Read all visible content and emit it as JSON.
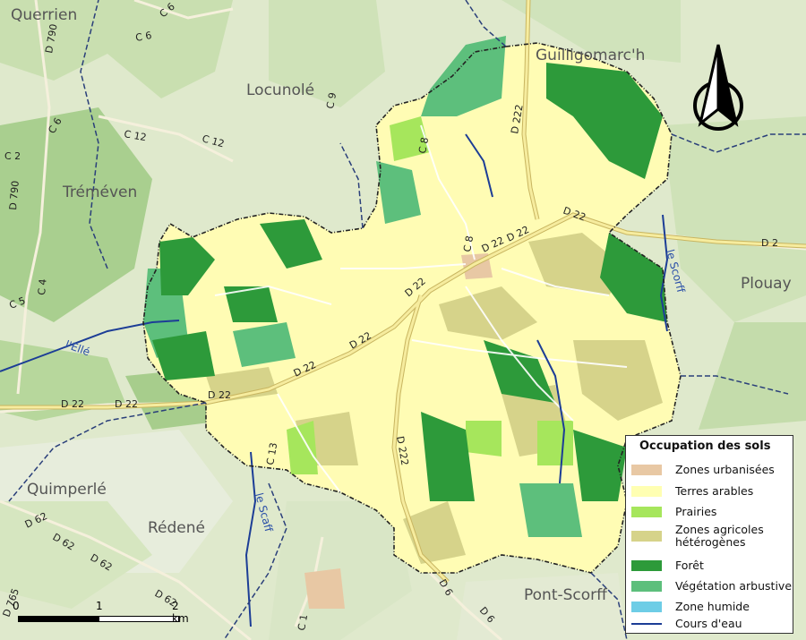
{
  "map": {
    "places": [
      {
        "name": "Querrien"
      },
      {
        "name": "Guilligomarc'h"
      },
      {
        "name": "Locunolé"
      },
      {
        "name": "Tréméven"
      },
      {
        "name": "Plouay"
      },
      {
        "name": "Quimperlé"
      },
      {
        "name": "Rédené"
      },
      {
        "name": "Pont-Scorff"
      }
    ],
    "roads": [
      "D 790",
      "C 6",
      "C 6",
      "C 6",
      "C 12",
      "C 12",
      "C 9",
      "C 2",
      "D 790",
      "C 4",
      "C 5",
      "C 8",
      "D 222",
      "C 8",
      "D 22",
      "D 22",
      "D 22",
      "D 2",
      "D 22",
      "D 22",
      "D 22",
      "D 22",
      "D 22",
      "D 22",
      "C 13",
      "D 222",
      "D 62",
      "D 62",
      "D 62",
      "D 62",
      "D 765",
      "C 1",
      "D 6",
      "D 6"
    ],
    "rivers": [
      "l'Ellé",
      "le Scorff",
      "le Scaff"
    ]
  },
  "legend": {
    "title": "Occupation des sols",
    "items": [
      {
        "label": "Zones urbanisées",
        "color": "#e8c8a4",
        "kind": "box"
      },
      {
        "label": "Terres arables",
        "color": "#ffffb2",
        "kind": "box"
      },
      {
        "label": "Prairies",
        "color": "#a6e65c",
        "kind": "box"
      },
      {
        "label": "Zones agricoles hétérogènes",
        "color": "#d6d38a",
        "kind": "box"
      },
      {
        "label": "Forêt",
        "color": "#2d9a3a",
        "kind": "box"
      },
      {
        "label": "Végétation arbustive",
        "color": "#5dbf7c",
        "kind": "box"
      },
      {
        "label": "Zone humide",
        "color": "#6ecde6",
        "kind": "box"
      },
      {
        "label": "Cours d'eau",
        "color": "#1c3d96",
        "kind": "line"
      }
    ]
  },
  "scale": {
    "zero": "0",
    "one": "1",
    "two": "2 km"
  }
}
